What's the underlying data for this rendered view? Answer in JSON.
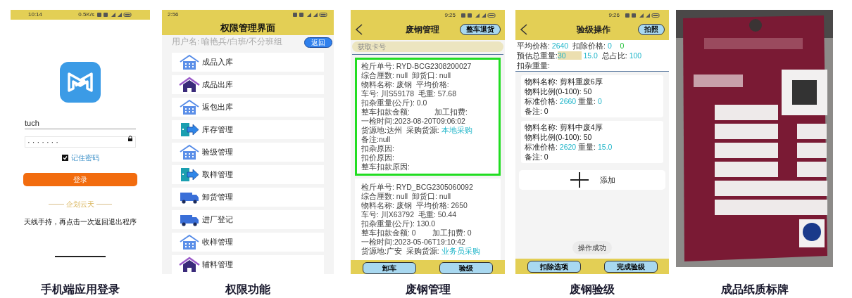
{
  "panels": [
    {
      "kind": "login",
      "caption": "手机端应用登录",
      "status_time": "10:14",
      "status_speed": "0.5K/s",
      "username": "tuch",
      "password": "· · · · · · ·",
      "remember": {
        "label": "记住密码",
        "checked": true
      },
      "login_button": "登录",
      "footer": "企划云天",
      "toast": "天线手持，再点击一次返回退出程序"
    },
    {
      "kind": "menu",
      "caption": "权限功能",
      "status_time": "2:56",
      "title": "权限管理界面",
      "user": "用户名: 喻艳兵/白班/不分班组",
      "back_button": "返回",
      "items": [
        {
          "label": "成品入库",
          "kind": "building"
        },
        {
          "label": "成品出库",
          "kind": "home"
        },
        {
          "label": "返包出库",
          "kind": "building"
        },
        {
          "label": "库存管理",
          "kind": "exit"
        },
        {
          "label": "验级管理",
          "kind": "building"
        },
        {
          "label": "取样管理",
          "kind": "exit"
        },
        {
          "label": "卸货管理",
          "kind": "truck"
        },
        {
          "label": "进厂登记",
          "kind": "truck"
        },
        {
          "label": "收样管理",
          "kind": "building"
        },
        {
          "label": "辅料管理",
          "kind": "home"
        }
      ]
    },
    {
      "kind": "scrap",
      "caption": "废钢管理",
      "status_time": "9:25",
      "title": "废钢管理",
      "top_button": "整车退货",
      "search": {
        "placeholder": "获取卡号"
      },
      "records": [
        {
          "selected": true,
          "lines": [
            "检斤单号: RYD-BCG2308200027",
            "综合厘数: null  卸货口: null",
            "物料名称: 废钢  平均价格:",
            "车号: 川S59178  毛重: 57.68",
            "扣杂重量(公斤): 0.0",
            "整车扣款金额:            加工扣费:",
            "一检时间:2023-08-20T09:06:02",
            [
              {
                "text": "货源地:达州  采购货源: ",
                "kind": "label"
              },
              {
                "text": "本地采购",
                "kind": "value"
              }
            ],
            "备注:null",
            "扣杂原因:",
            "扣价原因:",
            "整车扣款原因:"
          ]
        },
        {
          "selected": false,
          "lines": [
            "检斤单号: RYD_BCG2305060092",
            "综合厘数: null  卸货口: null",
            "物料名称: 废钢  平均价格: 2650",
            "车号: 川X63792  毛重: 50.44",
            "扣杂重量(公斤): 130.0",
            "整车扣款金额: 0        加工扣费: 0",
            "一检时间:2023-05-06T19:10:42",
            [
              {
                "text": "货源地:广安  采购货源: ",
                "kind": "label"
              },
              {
                "text": "业务员采购",
                "kind": "value"
              }
            ]
          ]
        }
      ],
      "buttons": [
        "卸车",
        "验级"
      ]
    },
    {
      "kind": "grading",
      "caption": "废钢验级",
      "status_time": "9:26",
      "title": "验级操作",
      "top_button": "拍照",
      "summary": [
        [
          {
            "text": "平均价格: ",
            "kind": "label"
          },
          {
            "text": "2640",
            "kind": "value"
          },
          {
            "text": "  扣除价格: ",
            "kind": "label"
          },
          {
            "text": "0",
            "kind": "value"
          },
          {
            "text": "    0",
            "kind": "ok"
          }
        ],
        [
          {
            "text": "预估总重量:",
            "kind": "label"
          },
          {
            "text": "30",
            "kind": "input"
          },
          {
            "text": " 15.0  ",
            "kind": "value"
          },
          {
            "text": "总占比: ",
            "kind": "label"
          },
          {
            "text": "100",
            "kind": "value"
          }
        ],
        [
          {
            "text": "扣杂重量:",
            "kind": "label"
          }
        ]
      ],
      "materials": [
        {
          "lines": [
            "物料名称: 剪料重废6厚",
            "物料比例(0-100): 50",
            [
              {
                "text": "标准价格: ",
                "kind": "label"
              },
              {
                "text": "2660",
                "kind": "value"
              },
              {
                "text": " 重量: ",
                "kind": "label"
              },
              {
                "text": "0",
                "kind": "value"
              }
            ],
            "备注: 0"
          ]
        },
        {
          "lines": [
            "物料名称: 剪料中废4厚",
            "物料比例(0-100): 50",
            [
              {
                "text": "标准价格: ",
                "kind": "label"
              },
              {
                "text": "2620",
                "kind": "value"
              },
              {
                "text": " 重量: ",
                "kind": "label"
              },
              {
                "text": "15.0",
                "kind": "value"
              }
            ],
            "备注: 0"
          ]
        }
      ],
      "add_button": "添加",
      "toast": "操作成功",
      "buttons": [
        "扣除选项",
        "完成验级"
      ]
    },
    {
      "kind": "picture",
      "caption": "成品纸质标牌"
    }
  ]
}
